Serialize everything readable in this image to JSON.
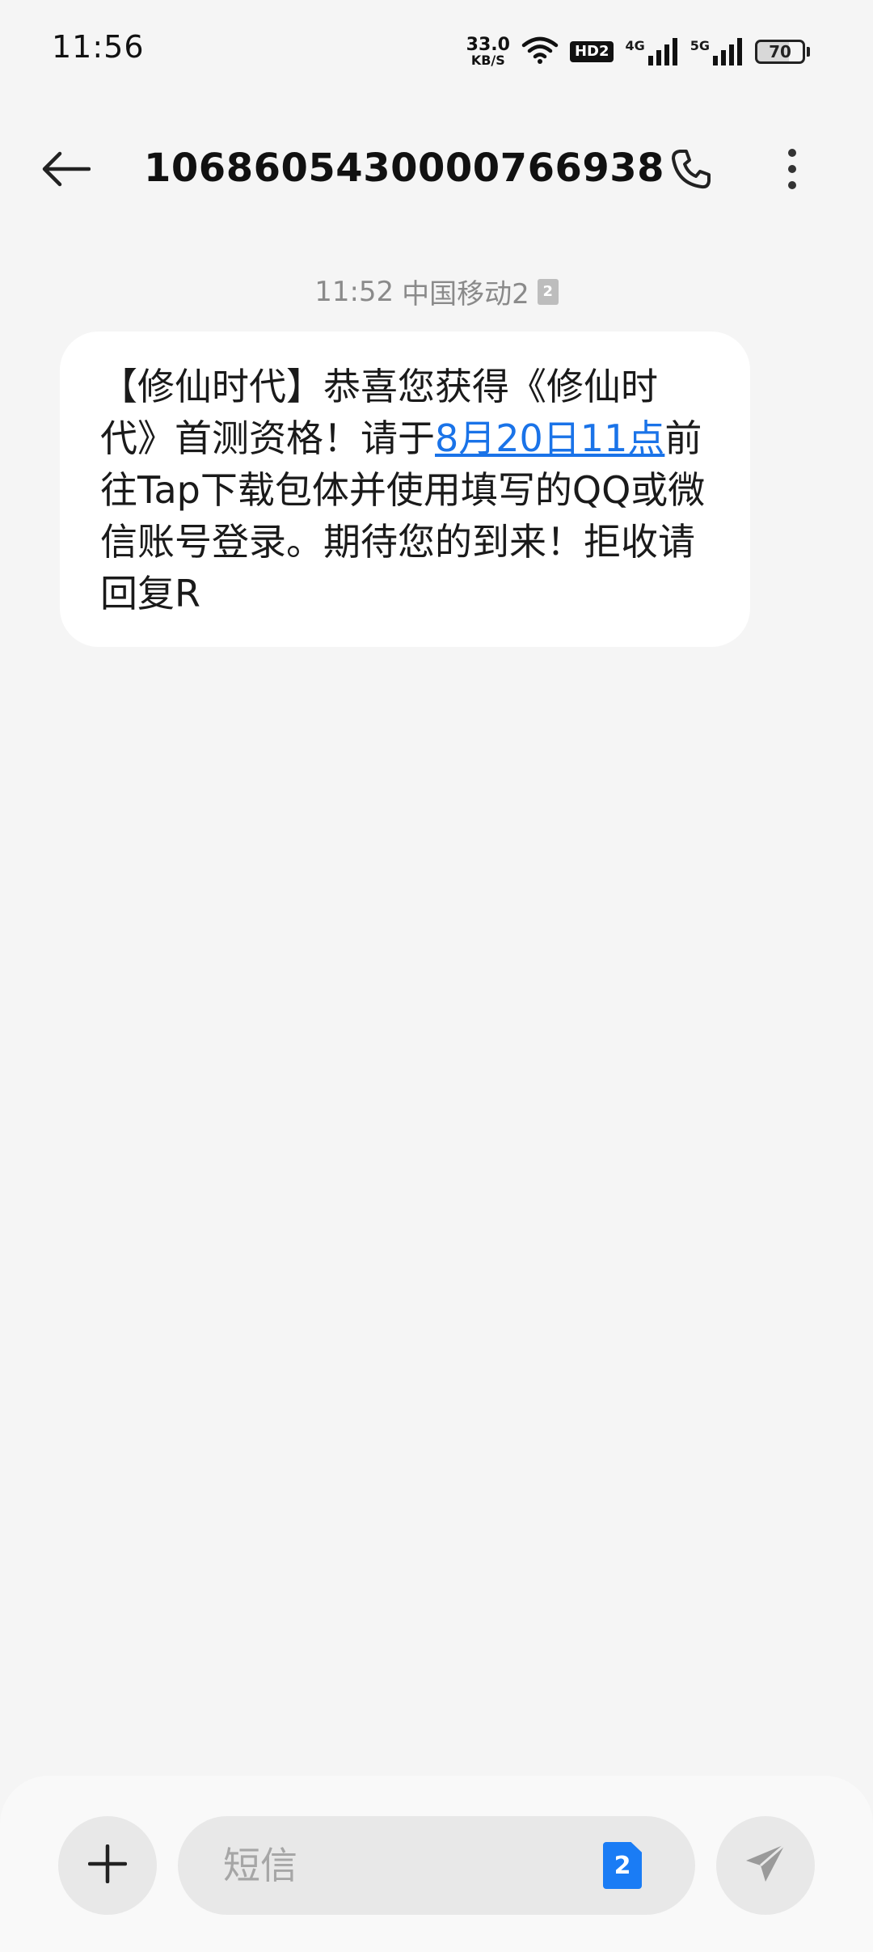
{
  "status_bar": {
    "time": "11:56",
    "net_speed_value": "33.0",
    "net_speed_unit": "KB/S",
    "hd_label": "HD2",
    "signal1_label": "4G",
    "signal2_label": "5G",
    "battery_level": "70",
    "icons": [
      "wifi-icon",
      "signal-icon",
      "battery-icon"
    ]
  },
  "header": {
    "title": "1068605430000766938",
    "icons": [
      "back-arrow-icon",
      "phone-icon",
      "more-vertical-icon"
    ]
  },
  "message": {
    "time": "11:52",
    "carrier": "中国移动2",
    "sim_slot": "2",
    "text_before_link": "【修仙时代】恭喜您获得《修仙时代》首测资格！请于",
    "link_text": "8月20日11点",
    "text_after_link": "前往Tap下载包体并使用填写的QQ或微信账号登录。期待您的到来！拒收请回复R"
  },
  "compose": {
    "placeholder": "短信",
    "sim_slot": "2",
    "icons": [
      "plus-icon",
      "send-icon"
    ],
    "accent_color": "#1a7cf5"
  },
  "colors": {
    "background": "#f5f5f5",
    "bubble": "#ffffff",
    "link": "#1a73e8"
  }
}
